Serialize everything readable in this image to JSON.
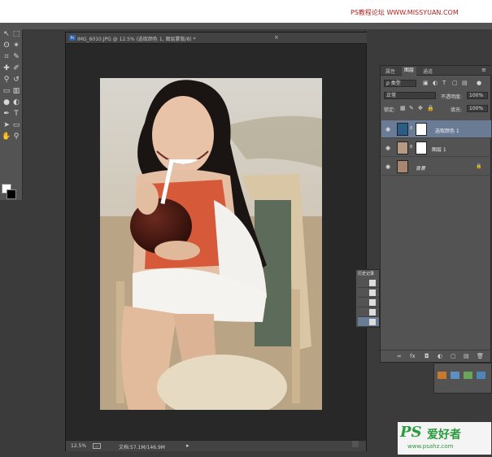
{
  "watermark_top": "PS教程论坛 WWW.MISSYUAN.COM",
  "document": {
    "tab_title": "IMG_6010.JPG @ 12.5% (选取颜色 1, 图层蒙版/8) *",
    "close_glyph": "×",
    "zoom": "12.5%",
    "doc_info": "文档:57.1M/146.9M",
    "arrow": "▸"
  },
  "tools": {
    "icons": [
      "move-icon",
      "marquee-icon",
      "lasso-icon",
      "magic-wand-icon",
      "crop-icon",
      "eyedropper-icon",
      "healing-brush-icon",
      "brush-icon",
      "stamp-icon",
      "history-brush-icon",
      "eraser-icon",
      "gradient-icon",
      "blur-icon",
      "dodge-icon",
      "pen-icon",
      "type-icon",
      "path-select-icon",
      "shape-icon",
      "hand-icon",
      "zoom-icon"
    ],
    "glyphs": [
      "↖",
      "⬚",
      "ʘ",
      "✶",
      "⌗",
      "✎",
      "✚",
      "✐",
      "⚲",
      "↺",
      "▭",
      "▥",
      "●",
      "◐",
      "✒",
      "T",
      "➤",
      "▭",
      "✋",
      "⚲"
    ]
  },
  "layers_panel": {
    "tabs": [
      "属性",
      "图层",
      "通道"
    ],
    "active_tab": "图层",
    "filter_kind": "ρ 类型",
    "blend_mode": "正常",
    "opacity_label": "不透明度:",
    "opacity_value": "100%",
    "lock_label": "锁定:",
    "fill_label": "填充:",
    "fill_value": "100%",
    "layers": [
      {
        "name": "选取颜色 1",
        "type": "adjustment",
        "selected": true
      },
      {
        "name": "图层 1",
        "type": "pixel",
        "selected": false
      },
      {
        "name": "背景",
        "type": "background",
        "selected": false
      }
    ],
    "bottom_icons": [
      "∞",
      "fx",
      "◘",
      "◐",
      "▢",
      "▤",
      "🗑"
    ]
  },
  "history": {
    "title": "历史记录",
    "count": 5,
    "active_index": 4
  },
  "watermark_bottom": {
    "logo": "PS",
    "site_name": "爱好者",
    "url": "www.psahz.com"
  },
  "colors": {
    "workspace": "#3b3b3b",
    "panel": "#535353",
    "selection": "#6a7b95",
    "watermark_green": "#2a9a3c",
    "watermark_red": "#b41e1e"
  }
}
